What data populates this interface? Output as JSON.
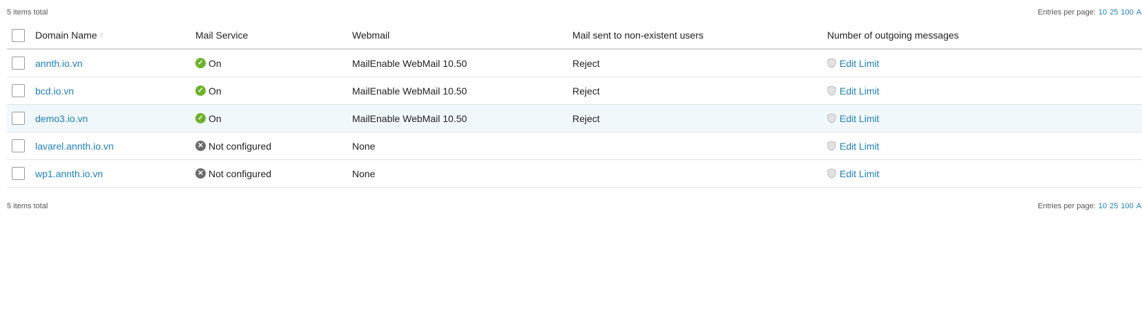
{
  "pager": {
    "total_text": "5 items total",
    "entries_label": "Entries per page:",
    "options": [
      "10",
      "25",
      "100",
      "All"
    ]
  },
  "columns": {
    "domain": "Domain Name",
    "mail_service": "Mail Service",
    "webmail": "Webmail",
    "nonexistent": "Mail sent to non-existent users",
    "outgoing": "Number of outgoing messages"
  },
  "sort_indicator": "↑",
  "rows": [
    {
      "domain": "annth.io.vn",
      "status_icon": "check-circle-icon",
      "status": "On",
      "webmail": "MailEnable WebMail 10.50",
      "nonexistent": "Reject",
      "action": "Edit Limit"
    },
    {
      "domain": "bcd.io.vn",
      "status_icon": "check-circle-icon",
      "status": "On",
      "webmail": "MailEnable WebMail 10.50",
      "nonexistent": "Reject",
      "action": "Edit Limit"
    },
    {
      "domain": "demo3.io.vn",
      "status_icon": "check-circle-icon",
      "status": "On",
      "webmail": "MailEnable WebMail 10.50",
      "nonexistent": "Reject",
      "action": "Edit Limit"
    },
    {
      "domain": "lavarel.annth.io.vn",
      "status_icon": "x-circle-icon",
      "status": "Not configured",
      "webmail": "None",
      "nonexistent": "",
      "action": "Edit Limit"
    },
    {
      "domain": "wp1.annth.io.vn",
      "status_icon": "x-circle-icon",
      "status": "Not configured",
      "webmail": "None",
      "nonexistent": "",
      "action": "Edit Limit"
    }
  ],
  "colors": {
    "link": "#1f7fb8",
    "status_on": "#6eb22d",
    "status_off": "#6c6c6c",
    "row_highlight": "#f1f8fb"
  }
}
